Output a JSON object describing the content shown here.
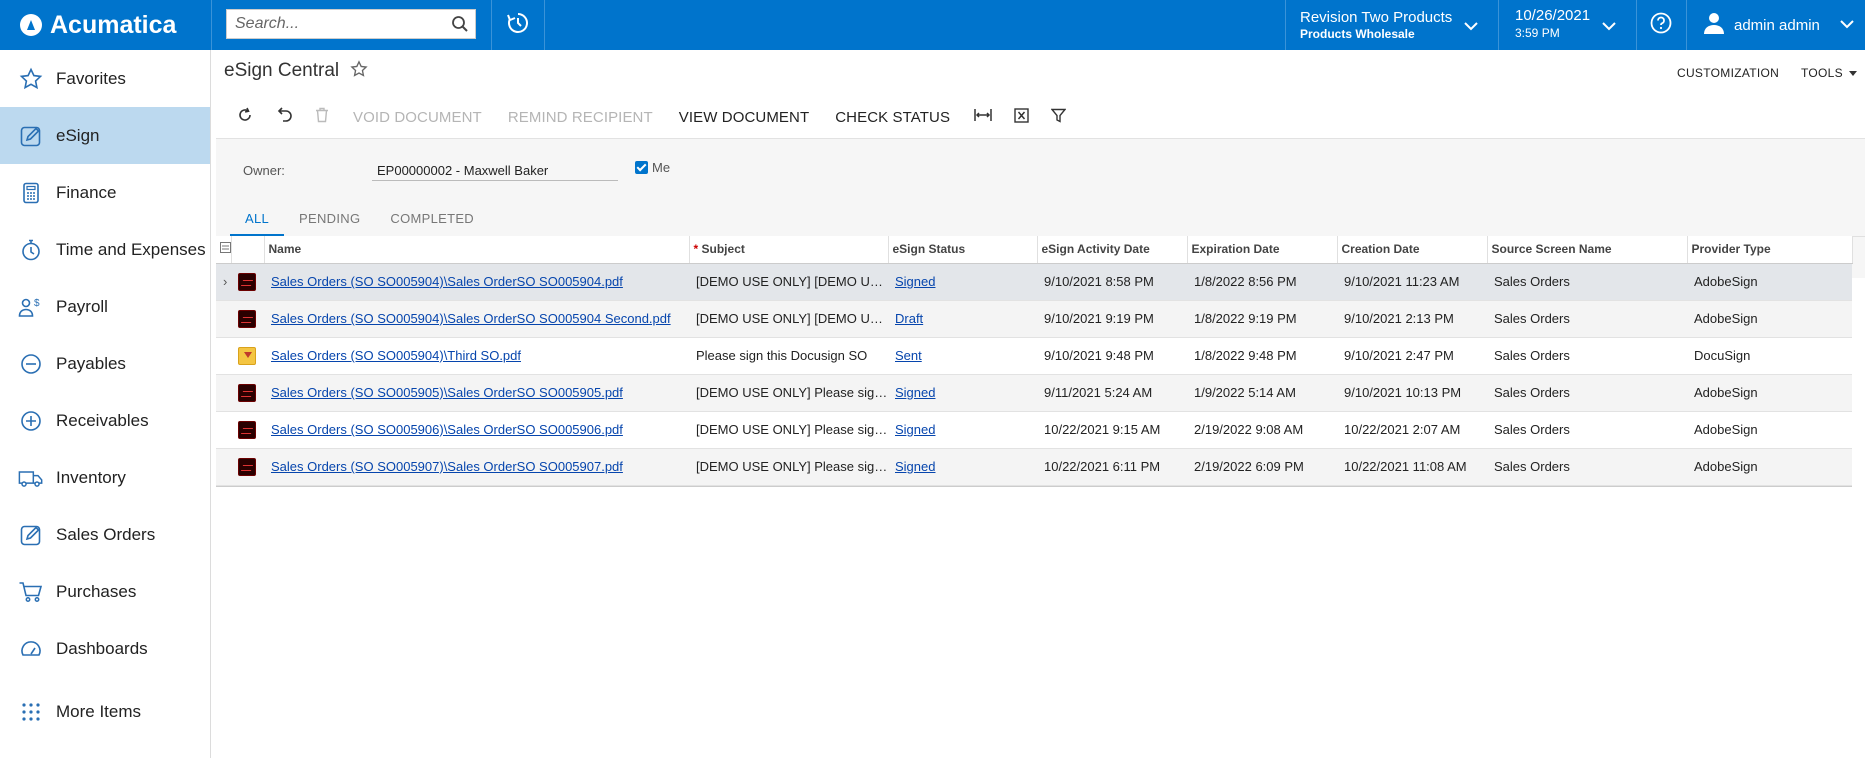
{
  "app": {
    "logo_text": "Acumatica",
    "search_placeholder": "Search...",
    "branch_line1": "Revision Two Products",
    "branch_line2": "Products Wholesale",
    "date_line1": "10/26/2021",
    "date_line2": "3:59 PM",
    "user_name": "admin admin"
  },
  "sidebar": {
    "items": [
      {
        "label": "Favorites",
        "icon": "star-icon"
      },
      {
        "label": "eSign",
        "icon": "pencil-box-icon"
      },
      {
        "label": "Finance",
        "icon": "calculator-icon"
      },
      {
        "label": "Time and Expenses",
        "icon": "stopwatch-icon"
      },
      {
        "label": "Payroll",
        "icon": "people-dollar-icon"
      },
      {
        "label": "Payables",
        "icon": "minus-circle-icon"
      },
      {
        "label": "Receivables",
        "icon": "plus-circle-icon"
      },
      {
        "label": "Inventory",
        "icon": "truck-icon"
      },
      {
        "label": "Sales Orders",
        "icon": "pencil-box-icon"
      },
      {
        "label": "Purchases",
        "icon": "cart-icon"
      },
      {
        "label": "Dashboards",
        "icon": "gauge-icon"
      }
    ],
    "more_label": "More Items",
    "active_index": 1
  },
  "page": {
    "title": "eSign Central",
    "customization": "CUSTOMIZATION",
    "tools": "TOOLS"
  },
  "toolbar": {
    "void_document": "VOID DOCUMENT",
    "remind_recipient": "REMIND RECIPIENT",
    "view_document": "VIEW DOCUMENT",
    "check_status": "CHECK STATUS"
  },
  "filter": {
    "owner_label": "Owner:",
    "owner_value": "EP00000002 - Maxwell Baker",
    "me_label": "Me",
    "me_checked": true
  },
  "tabs": [
    {
      "label": "ALL",
      "active": true
    },
    {
      "label": "PENDING",
      "active": false
    },
    {
      "label": "COMPLETED",
      "active": false
    }
  ],
  "grid": {
    "columns": {
      "name": "Name",
      "subject_req": "*",
      "subject": "Subject",
      "status": "eSign Status",
      "activity": "eSign Activity Date",
      "expiration": "Expiration Date",
      "creation": "Creation Date",
      "source": "Source Screen Name",
      "provider": "Provider Type"
    },
    "rows": [
      {
        "type": "pdf",
        "name": "Sales Orders (SO SO005904)\\Sales OrderSO SO005904.pdf",
        "subject": "[DEMO USE ONLY] [DEMO USE ONLY] Please sign",
        "status": "Signed",
        "activity": "9/10/2021 8:58 PM",
        "expiration": "1/8/2022 8:56 PM",
        "creation": "9/10/2021 11:23 AM",
        "source": "Sales Orders",
        "provider": "AdobeSign"
      },
      {
        "type": "pdf",
        "name": "Sales Orders (SO SO005904)\\Sales OrderSO SO005904 Second.pdf",
        "subject": "[DEMO USE ONLY] [DEMO USE ONLY] Please sign",
        "status": "Draft",
        "activity": "9/10/2021 9:19 PM",
        "expiration": "1/8/2022 9:19 PM",
        "creation": "9/10/2021 2:13 PM",
        "source": "Sales Orders",
        "provider": "AdobeSign"
      },
      {
        "type": "zip",
        "name": "Sales Orders (SO SO005904)\\Third SO.pdf",
        "subject": "Please sign this Docusign SO",
        "status": "Sent",
        "activity": "9/10/2021 9:48 PM",
        "expiration": "1/8/2022 9:48 PM",
        "creation": "9/10/2021 2:47 PM",
        "source": "Sales Orders",
        "provider": "DocuSign"
      },
      {
        "type": "pdf",
        "name": "Sales Orders (SO SO005905)\\Sales OrderSO SO005905.pdf",
        "subject": "[DEMO USE ONLY] Please sign this document",
        "status": "Signed",
        "activity": "9/11/2021 5:24 AM",
        "expiration": "1/9/2022 5:14 AM",
        "creation": "9/10/2021 10:13 PM",
        "source": "Sales Orders",
        "provider": "AdobeSign"
      },
      {
        "type": "pdf",
        "name": "Sales Orders (SO SO005906)\\Sales OrderSO SO005906.pdf",
        "subject": "[DEMO USE ONLY] Please sign this document",
        "status": "Signed",
        "activity": "10/22/2021 9:15 AM",
        "expiration": "2/19/2022 9:08 AM",
        "creation": "10/22/2021 2:07 AM",
        "source": "Sales Orders",
        "provider": "AdobeSign"
      },
      {
        "type": "pdf",
        "name": "Sales Orders (SO SO005907)\\Sales OrderSO SO005907.pdf",
        "subject": "[DEMO USE ONLY] Please sign this document",
        "status": "Signed",
        "activity": "10/22/2021 6:11 PM",
        "expiration": "2/19/2022 6:09 PM",
        "creation": "10/22/2021 11:08 AM",
        "source": "Sales Orders",
        "provider": "AdobeSign"
      }
    ]
  }
}
